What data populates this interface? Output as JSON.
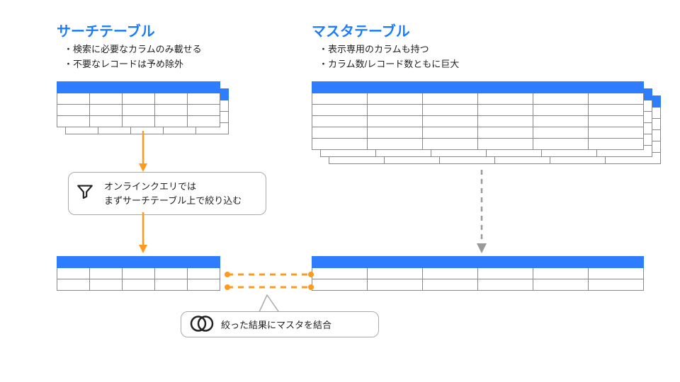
{
  "search": {
    "title": "サーチテーブル",
    "bullets": [
      "検索に必要なカラムのみ載せる",
      "不要なレコードは予め除外"
    ]
  },
  "master": {
    "title": "マスタテーブル",
    "bullets": [
      "表示専用のカラムも持つ",
      "カラム数/レコード数ともに巨大"
    ]
  },
  "callout_filter": {
    "line1": "オンラインクエリでは",
    "line2": "まずサーチテーブル上で絞り込む"
  },
  "callout_join": "絞った結果にマスタを結合",
  "colors": {
    "accent": "#1a7cff",
    "header": "#2f7dff",
    "orange": "#ff9a1f",
    "grey": "#9a9a9a"
  }
}
